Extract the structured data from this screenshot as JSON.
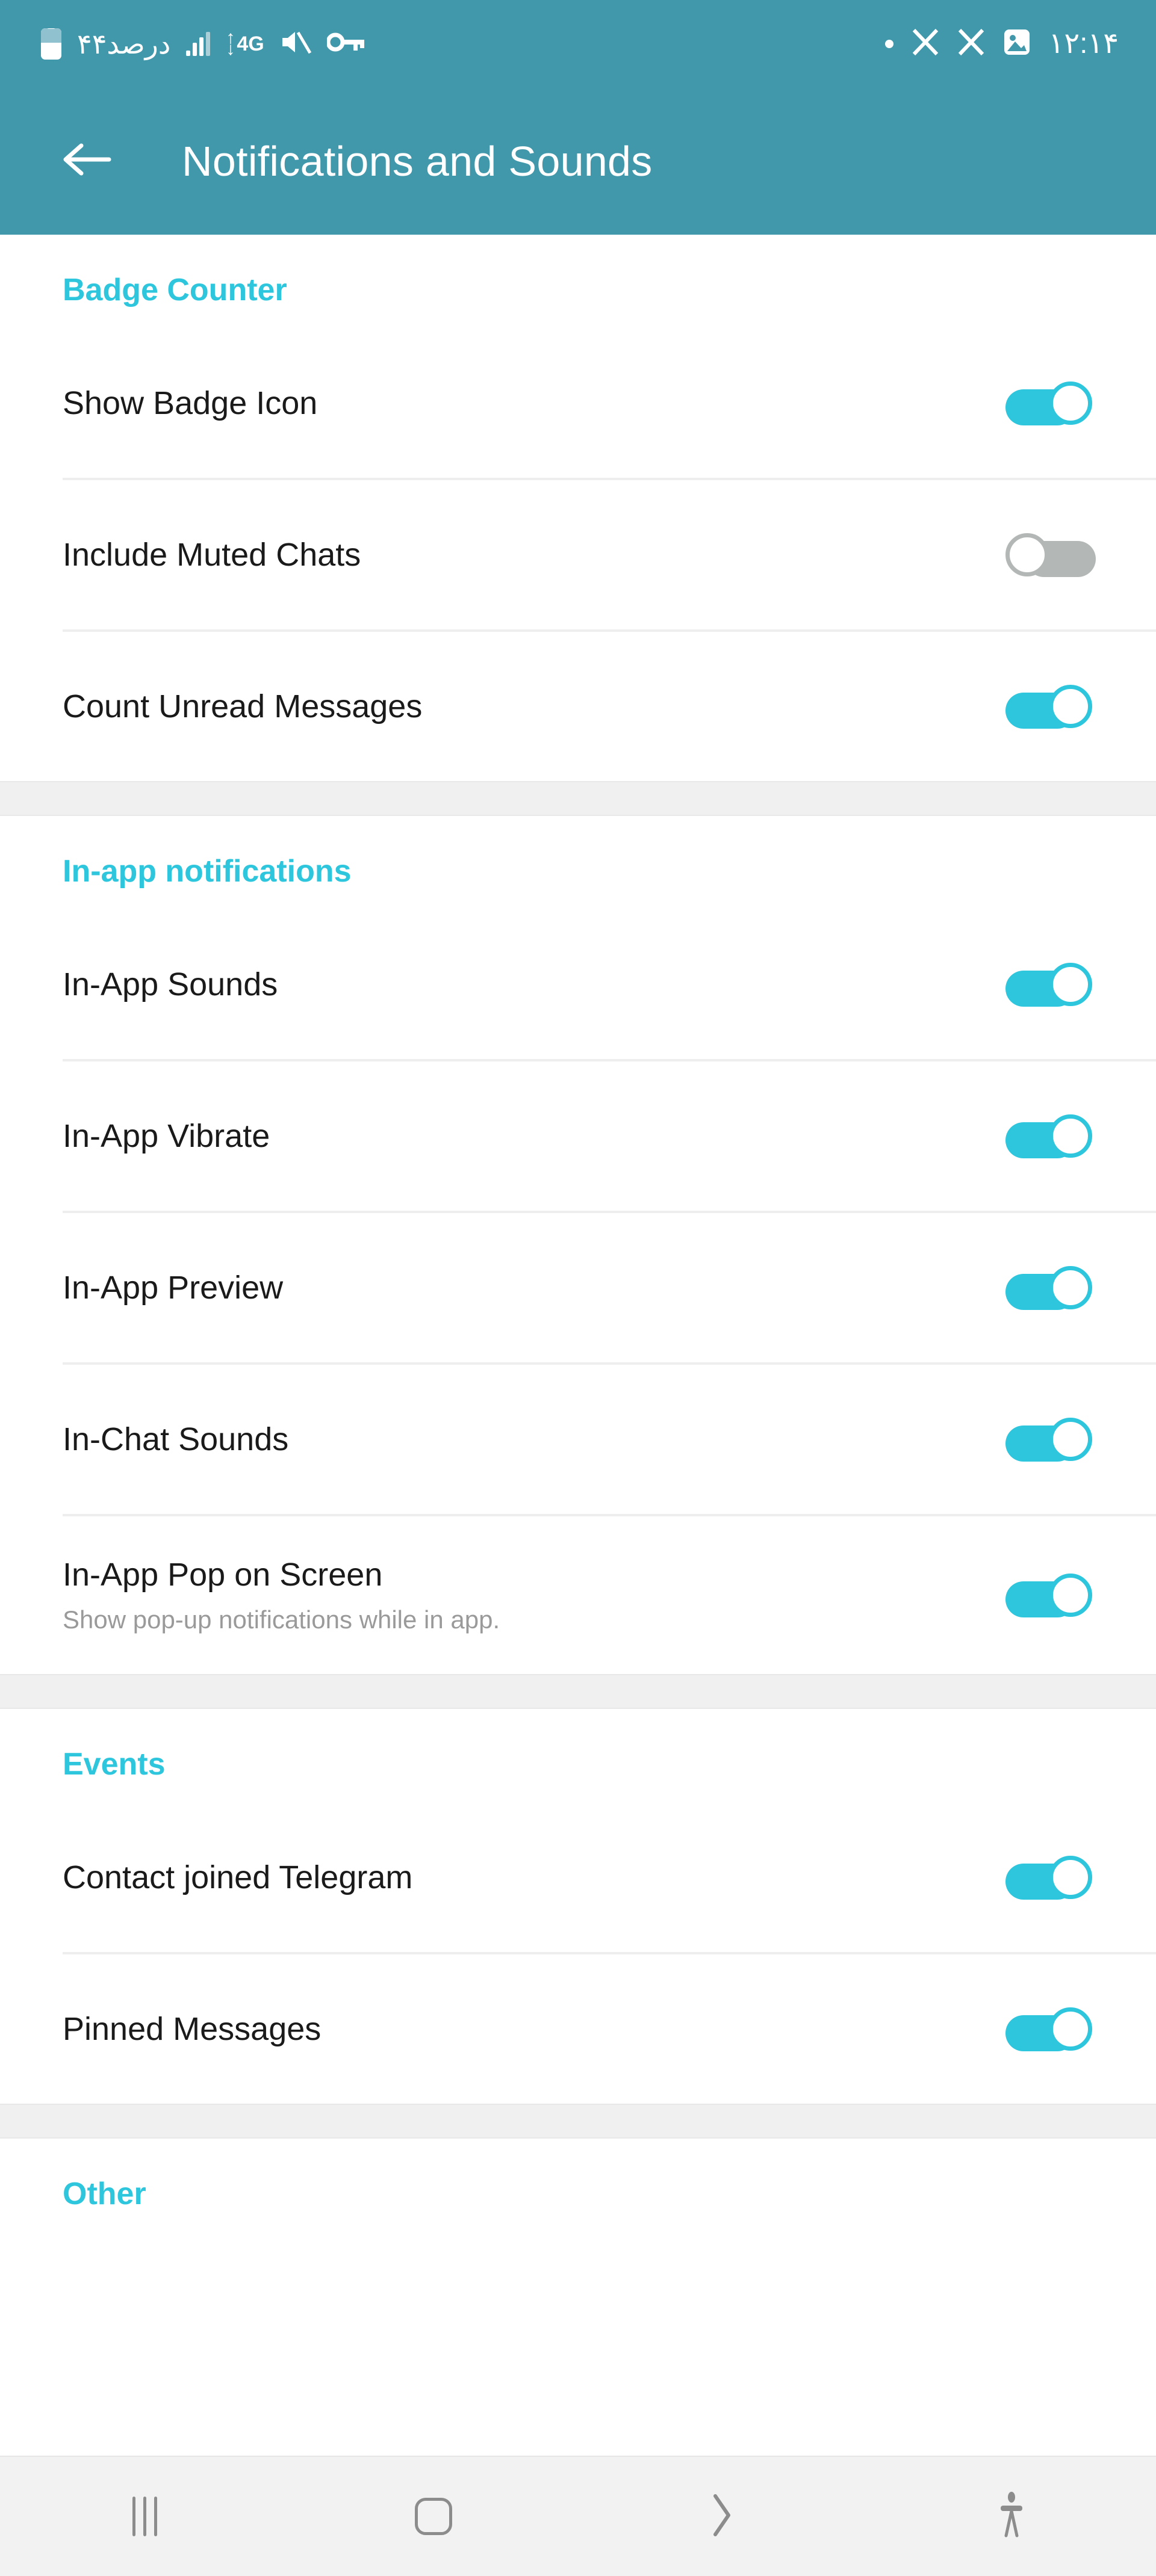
{
  "statusbar": {
    "battery_text": "۴۴درصد",
    "network_label": "4G",
    "arrow_down": "↓",
    "arrow_up": "↑",
    "time": "۱۲:۱۴",
    "icons": [
      "battery-icon",
      "signal-bars-icon",
      "mobile-data-4g-icon",
      "mute-icon",
      "vpn-key-icon",
      "dot-indicator-icon",
      "x-app-icon",
      "x-app-icon",
      "screenshot-image-icon"
    ]
  },
  "appbar": {
    "back_icon": "arrow-left-icon",
    "title": "Notifications and Sounds"
  },
  "colors": {
    "header_teal": "#4298ab",
    "accent_cyan": "#2ec6dd",
    "toggle_off_gray": "#b3b7b6",
    "divider_gray": "#eeeeee",
    "section_gap_gray": "#f0f0f0",
    "navbar_gray": "#f2f2f2"
  },
  "sections": [
    {
      "title": "Badge Counter",
      "rows": [
        {
          "label": "Show Badge Icon",
          "sub": "",
          "state": "on"
        },
        {
          "label": "Include Muted Chats",
          "sub": "",
          "state": "off"
        },
        {
          "label": "Count Unread Messages",
          "sub": "",
          "state": "on"
        }
      ]
    },
    {
      "title": "In-app notifications",
      "rows": [
        {
          "label": "In-App Sounds",
          "sub": "",
          "state": "on"
        },
        {
          "label": "In-App Vibrate",
          "sub": "",
          "state": "on"
        },
        {
          "label": "In-App Preview",
          "sub": "",
          "state": "on"
        },
        {
          "label": "In-Chat Sounds",
          "sub": "",
          "state": "on"
        },
        {
          "label": "In-App Pop on Screen",
          "sub": "Show pop-up notifications while in app.",
          "state": "on"
        }
      ]
    },
    {
      "title": "Events",
      "rows": [
        {
          "label": "Contact joined Telegram",
          "sub": "",
          "state": "on"
        },
        {
          "label": "Pinned Messages",
          "sub": "",
          "state": "on"
        }
      ]
    },
    {
      "title": "Other",
      "rows": []
    }
  ],
  "navbar": {
    "items": [
      {
        "name": "recents-button",
        "icon": "recents-icon",
        "glyph": ""
      },
      {
        "name": "home-button",
        "icon": "home-icon",
        "glyph": ""
      },
      {
        "name": "back-button",
        "icon": "chevron-right-icon",
        "glyph": "❯"
      },
      {
        "name": "accessibility-button",
        "icon": "accessibility-person-icon",
        "glyph": ""
      }
    ]
  }
}
